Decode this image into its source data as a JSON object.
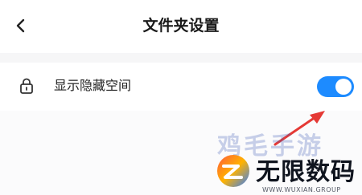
{
  "header": {
    "title": "文件夹设置",
    "back_icon": "chevron-left-icon"
  },
  "settings": [
    {
      "label": "显示隐藏空间",
      "icon": "lock-icon",
      "toggle_on": true
    }
  ],
  "colors": {
    "toggle_accent": "#1d8bff",
    "arrow": "#e53935"
  },
  "watermark": {
    "top_text": "鸡毛手游",
    "title": "无限数码",
    "subtitle": "WWW.WUXIAN.GROUP"
  }
}
